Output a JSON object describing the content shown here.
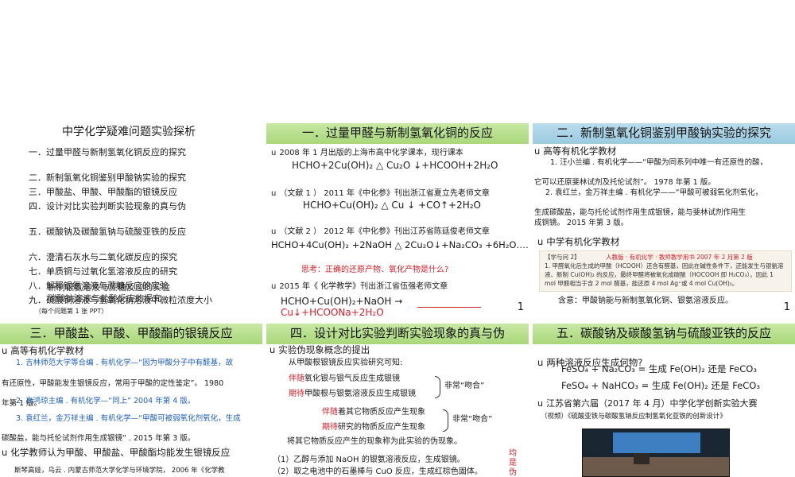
{
  "slide1": {
    "title": "中学化学疑难问题实验探析",
    "items": [
      "一．过量甲醛与新制氢氧化铜反应的探究",
      "二．新制氢氧化铜鉴别甲酸钠实验的探究",
      "三．甲酸盐、甲酸、甲酸酯的银镜反应",
      "四．设计对比实验判断实验现象的真与伪",
      "五．碳酸钠及碳酸氢钠与硫酸亚铁的反应",
      "六．澄清石灰水与二氧化碳反应的探究",
      "七．单质铜与过氧化氢溶液反应的研究",
      "八．解释银氨溶液与蔗糖反应的实验",
      "九．硫酸铜溶液与氢氧化钠溶液中微粒浓度大小"
    ],
    "overlay_items": [
      "新制银氨溶液与蔗糖反应的实验",
      "碳酸钠溶液与盐酸反应的探究"
    ],
    "footnote": "（每个问题第 1 张 PPT）"
  },
  "slide2": {
    "title": "一．过量甲醛与新制氢氧化铜的反应",
    "p1": "2008 年 1 月出版的上海市高中化学课本，现行课本",
    "eq1": "HCHO+2Cu(OH)₂ △ Cu₂O ↓+HCOOH+2H₂O",
    "p2": "（文献 1 ） 2011 年《中化参》刊出浙江省夏立先老师文章",
    "eq2": "HCHO+Cu(OH)₂ △ Cu ↓ +CO↑+2H₂O",
    "p3": "（文献 2 ） 2012 年《中化参》刊出江苏省陈廷俊老师文章",
    "eq3": "HCHO+4Cu(OH)₂ +2NaOH △ 2Cu₂O↓+Na₂CO₃ +6H₂O……",
    "think": "思考：正确的还原产物、氧化产物是什么?",
    "p4": "2015 年《 化学教学》刊出浙江省伍强老师文章",
    "eq4": "HCHO+Cu(OH)₂+NaOH →",
    "eq4b": "Cu↓+HCOONa+2H₂O",
    "page": "1"
  },
  "slide3": {
    "title": "二．新制氢氧化铜鉴别甲酸钠实验的探究",
    "h1": "高等有机化学教材",
    "l1": "1. 汪小兰编 . 有机化学——“甲酸为同系列中唯一有还原性的酸，",
    "l2": "它可以还原斐林试剂及托伦试剂”。 1978 年第 1 版。",
    "l3": "2. 袁红兰，金万祥主编 . 有机化学——“甲酸可被弱氧化剂氧化，",
    "l4": "生成碳酸盐，能与托伦试剂作用生成银镜，能与斐林试剂作用生",
    "l5": "成铜镜。 2015 年第 3 版。",
    "h2": "中学有机化学教材",
    "quote_tag": "【学与问 2】",
    "quote_src": "人教版 · 有机化学 · 教师教学用书 2007 年 2 月第 2 版",
    "quote_text": "1. 甲醛氧化后生成的甲酸（HCOOH）还含有醛基，因此在碱性条件下，还能发生与银氨溶液、新制 Cu(OH)₂ 的反应，最终甲醛将被氧化成碳酸（HOCOOH 即 H₂CO₃）。因此 1 mol 甲醛相当于含 2 mol 醛基，能还原 4 mol Ag⁺或 4 mol Cu(OH)₂。",
    "implication": "含意：甲酸钠能与新制氢氧化铜、银氨溶液反应。",
    "page": "1"
  },
  "slide4": {
    "title": "三．甲酸盐、甲酸、甲酸酯的银镜反应",
    "h1": "高等有机化学教材",
    "l1": "1. 吉林师范大学等合编 . 有机化学—“因为甲酸分子中有醛基，故",
    "l2": "有还原性，甲酸能发生银镜反应，常用于甲酸的定性鉴定”。 1980",
    "l3": "年第 1 版。",
    "l4": "2. 高鸿琼主编 . 有机化学—“同上” 2004 年第 4 版。",
    "l5": "3. 袁红兰，金万祥主编 . 有机化学—“甲酸可被弱氧化剂氧化，生成",
    "l6": "碳酸盐，能与托伦试剂作用生成银镜” . 2015 年第 3 版。",
    "h2": "化学教师认为甲酸、甲酸盐、甲酸酯均能发生银镜反应",
    "ref": "斯琴高娃，乌云 . 内蒙古师范大学化学与环境学院， 2006 年《化学教"
  },
  "slide5": {
    "title": "四．设计对比实验判断实验现象的真与伪",
    "h1": "实验伪现象概念的提出",
    "intro": "从甲酸根银镜反应实验研究可知:",
    "a1_red": "伴随",
    "a1": "氧化银与银气反应生成银镜",
    "a2_red": "期待",
    "a2": "甲酸根与银氨溶液反应生成银镜",
    "a_label": "非常“吻合”",
    "b1_red": "伴随",
    "b1": "着其它物质反应产生现象",
    "b2_red": "期待",
    "b2": "研究的物质反应产生现象",
    "b_label": "非常“吻合”",
    "summary": "将其它物质反应产生的现象称为此实验的伪现象。",
    "ex1": "（1）乙醇与添加 NaOH 的银氨溶液反应，生成银镜。",
    "ex2": "（2）取之电池中的石墨棒与 CuO 反应，生成红棕色固体。",
    "side_label": "均是伪"
  },
  "slide6": {
    "title": "五．碳酸钠及碳酸氢钠与硫酸亚铁的反应",
    "h1": "两种溶液反应生成何物?",
    "r1": "FeSO₄ + Na₂CO₃ = 生成 Fe(OH)₂ 还是 FeCO₃",
    "r2": "FeSO₄ + NaHCO₃ = 生成 Fe(OH)₂ 还是 FeCO₃",
    "h2": "江苏省第六届（2017 年 4 月）中学化学创新实验大赛",
    "video_note": "（视频）《硫酸亚铁与碳酸氢钠反应制氢氧化亚铁的创新设计》"
  },
  "colors": {
    "accent_red": "#d0202a",
    "accent_blue": "#1f5fbf",
    "title_green": "#a9d77a",
    "title_blue": "#9ccbe0"
  }
}
